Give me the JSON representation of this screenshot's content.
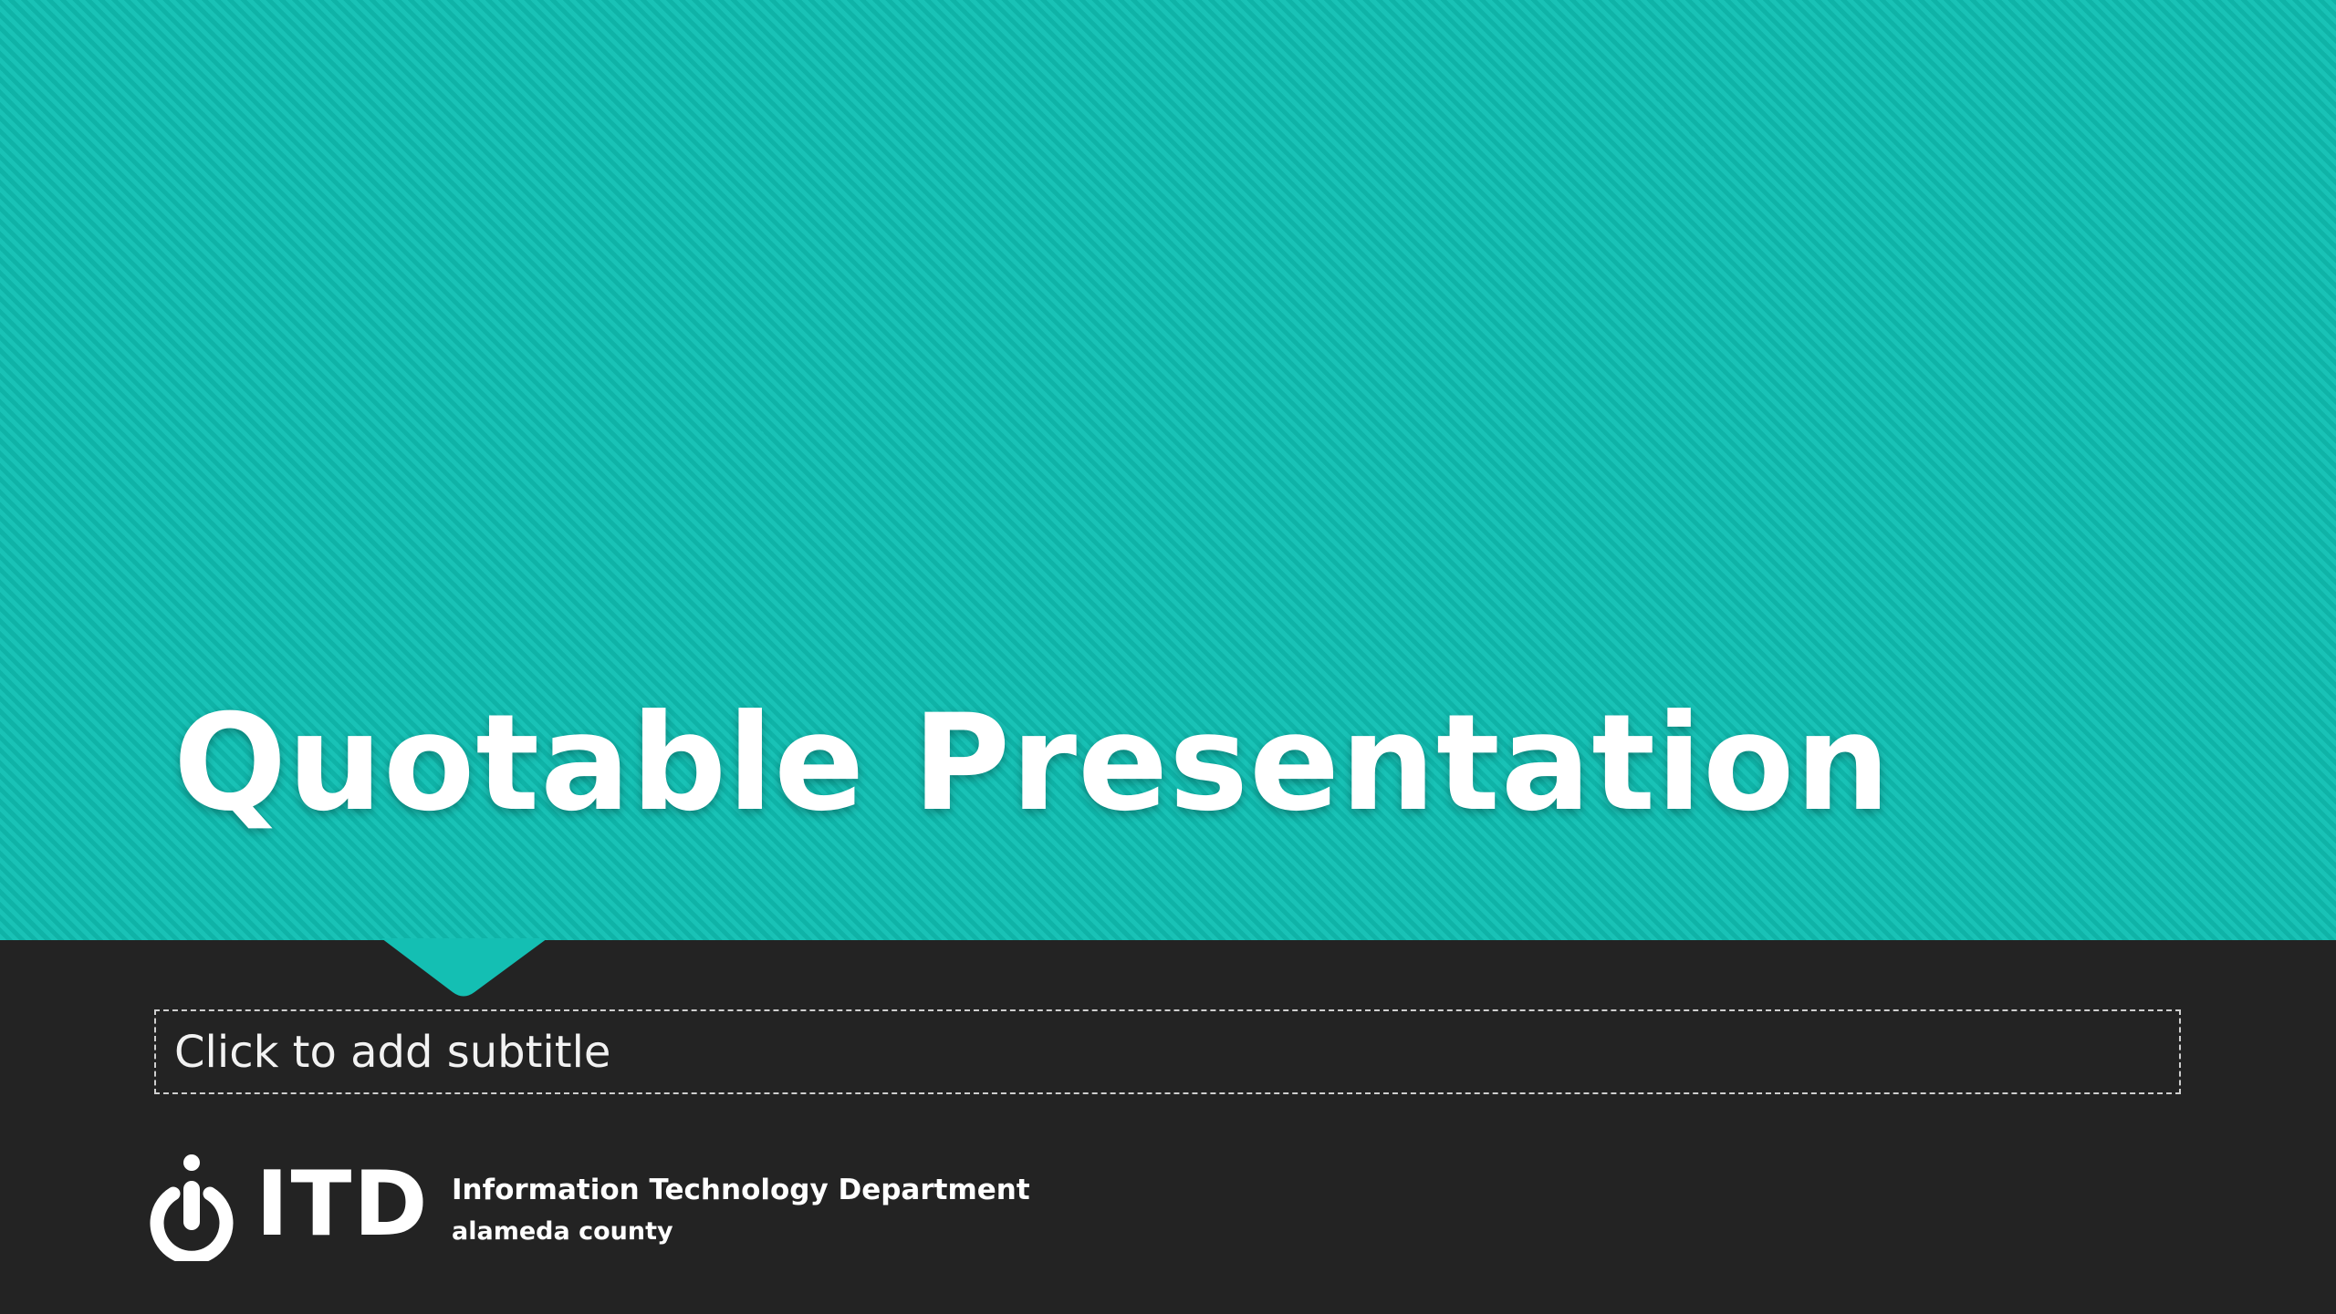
{
  "slide": {
    "title": "Quotable Presentation",
    "subtitle_placeholder": "Click to add subtitle"
  },
  "logo": {
    "icon": "power-icon",
    "wordmark": "ITD",
    "department": "Information Technology Department",
    "county": "alameda county"
  },
  "colors": {
    "top_band": "#14bfb3",
    "bottom_band": "#232323",
    "text": "#ffffff"
  }
}
